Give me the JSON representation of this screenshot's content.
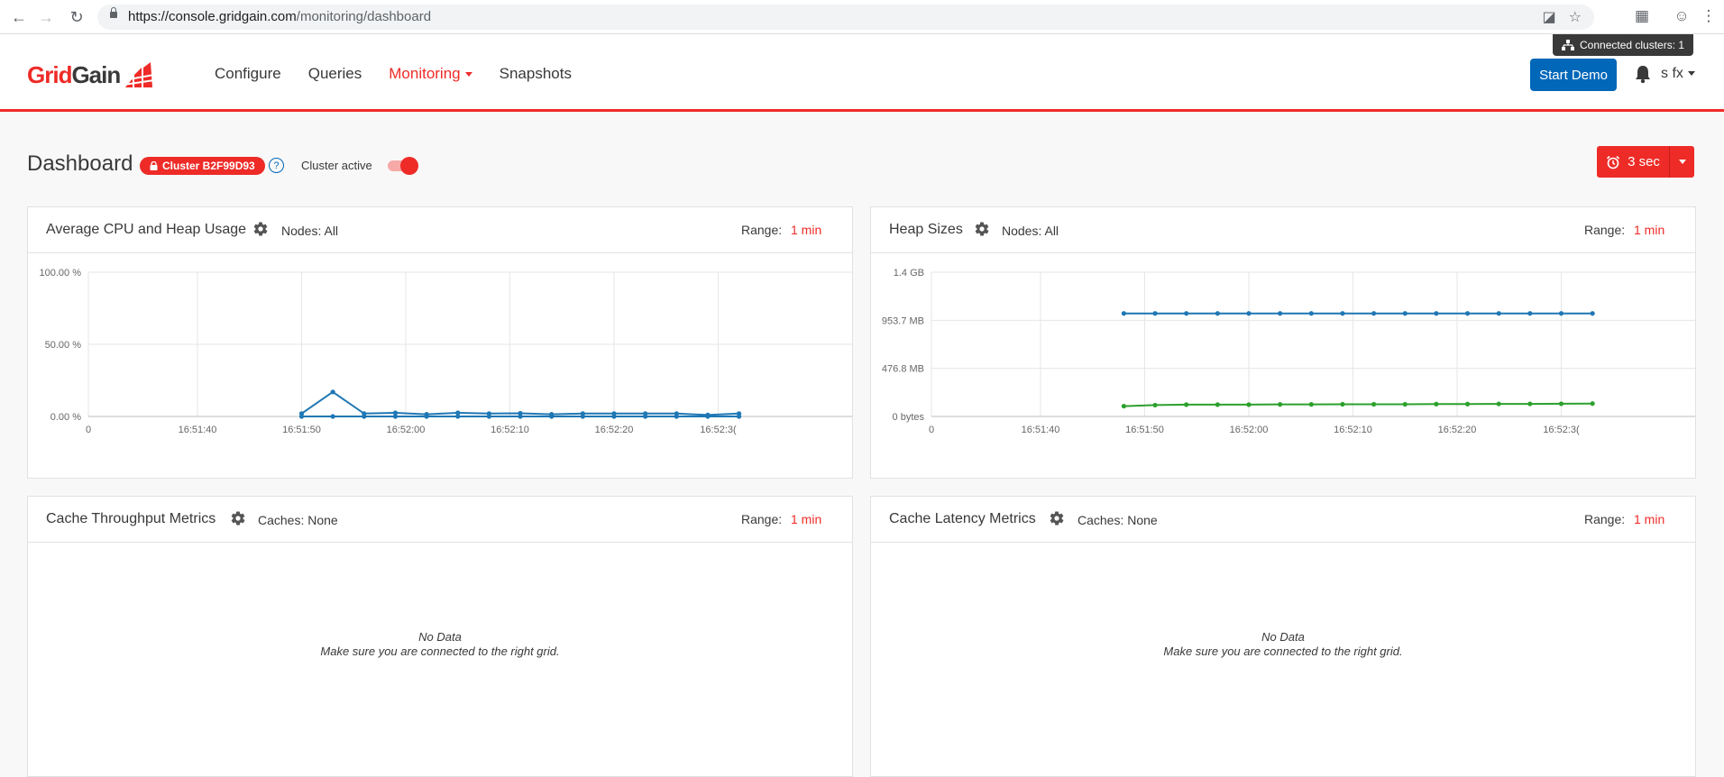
{
  "browser": {
    "url_host": "https://console.gridgain.com",
    "url_path": "/monitoring/dashboard"
  },
  "header": {
    "logo_part1": "Grid",
    "logo_part2": "Gain",
    "nav": [
      {
        "label": "Configure"
      },
      {
        "label": "Queries"
      },
      {
        "label": "Monitoring"
      },
      {
        "label": "Snapshots"
      }
    ],
    "connected_clusters": "Connected clusters: 1",
    "start_demo": "Start Demo",
    "user": "s fx"
  },
  "page": {
    "title": "Dashboard",
    "cluster_badge": "Cluster B2F99D93",
    "help": "?",
    "cluster_active_label": "Cluster active",
    "cluster_active": true,
    "refresh_label": "3 sec"
  },
  "colors": {
    "accent": "#ee2b27",
    "primary_blue": "#0067b9",
    "series_blue": "#1f77b4",
    "series_green": "#2ca02c"
  },
  "panels": {
    "cpu": {
      "title": "Average CPU and Heap Usage",
      "filter": "Nodes: All",
      "range_label": "Range:",
      "range_value": "1 min"
    },
    "heap": {
      "title": "Heap Sizes",
      "filter": "Nodes: All",
      "range_label": "Range:",
      "range_value": "1 min"
    },
    "throughput": {
      "title": "Cache Throughput Metrics",
      "filter": "Caches: None",
      "range_label": "Range:",
      "range_value": "1 min",
      "nodata_title": "No Data",
      "nodata_msg": "Make sure you are connected to the right grid."
    },
    "latency": {
      "title": "Cache Latency Metrics",
      "filter": "Caches: None",
      "range_label": "Range:",
      "range_value": "1 min",
      "nodata_title": "No Data",
      "nodata_msg": "Make sure you are connected to the right grid."
    }
  },
  "chart_data": [
    {
      "type": "line",
      "id": "cpu",
      "ytick_labels": [
        "100.00 %",
        "50.00 %",
        "0.00 %"
      ],
      "ylim": [
        0,
        100
      ],
      "xtick_labels": [
        "0",
        "16:51:40",
        "16:51:50",
        "16:52:00",
        "16:52:10",
        "16:52:20",
        "16:52:3("
      ],
      "grid": true,
      "series": [
        {
          "color": "#1f77b4",
          "x": [
            "16:51:50",
            "16:51:53",
            "16:51:56",
            "16:51:59",
            "16:52:02",
            "16:52:05",
            "16:52:08",
            "16:52:11",
            "16:52:14",
            "16:52:17",
            "16:52:20",
            "16:52:23",
            "16:52:26",
            "16:52:29",
            "16:52:32"
          ],
          "values": [
            2,
            17,
            2,
            2.5,
            1.5,
            2.5,
            2,
            2.2,
            1.5,
            2,
            2,
            2,
            2,
            1,
            2
          ]
        },
        {
          "color": "#1f77b4",
          "x": [
            "16:51:50",
            "16:51:53",
            "16:51:56",
            "16:51:59",
            "16:52:02",
            "16:52:05",
            "16:52:08",
            "16:52:11",
            "16:52:14",
            "16:52:17",
            "16:52:20",
            "16:52:23",
            "16:52:26",
            "16:52:29",
            "16:52:32"
          ],
          "values": [
            0,
            0,
            0,
            0,
            0,
            0,
            0,
            0,
            0,
            0,
            0,
            0,
            0,
            0,
            0
          ]
        }
      ]
    },
    {
      "type": "line",
      "id": "heap",
      "ytick_labels": [
        "1.4 GB",
        "953.7 MB",
        "476.8 MB",
        "0 bytes"
      ],
      "ylim": [
        0,
        1.4
      ],
      "yunit": "GB",
      "xtick_labels": [
        "0",
        "16:51:40",
        "16:51:50",
        "16:52:00",
        "16:52:10",
        "16:52:20",
        "16:52:3("
      ],
      "grid": true,
      "series": [
        {
          "color": "#1f77b4",
          "x": [
            "16:51:48",
            "16:51:51",
            "16:51:54",
            "16:51:57",
            "16:52:00",
            "16:52:03",
            "16:52:06",
            "16:52:09",
            "16:52:12",
            "16:52:15",
            "16:52:18",
            "16:52:21",
            "16:52:24",
            "16:52:27",
            "16:52:30",
            "16:52:33"
          ],
          "values": [
            1.0,
            1.0,
            1.0,
            1.0,
            1.0,
            1.0,
            1.0,
            1.0,
            1.0,
            1.0,
            1.0,
            1.0,
            1.0,
            1.0,
            1.0,
            1.0
          ]
        },
        {
          "color": "#2ca02c",
          "x": [
            "16:51:48",
            "16:51:51",
            "16:51:54",
            "16:51:57",
            "16:52:00",
            "16:52:03",
            "16:52:06",
            "16:52:09",
            "16:52:12",
            "16:52:15",
            "16:52:18",
            "16:52:21",
            "16:52:24",
            "16:52:27",
            "16:52:30",
            "16:52:33"
          ],
          "values": [
            0.1,
            0.11,
            0.115,
            0.115,
            0.115,
            0.117,
            0.117,
            0.118,
            0.118,
            0.118,
            0.12,
            0.12,
            0.122,
            0.122,
            0.123,
            0.125
          ]
        }
      ]
    }
  ]
}
